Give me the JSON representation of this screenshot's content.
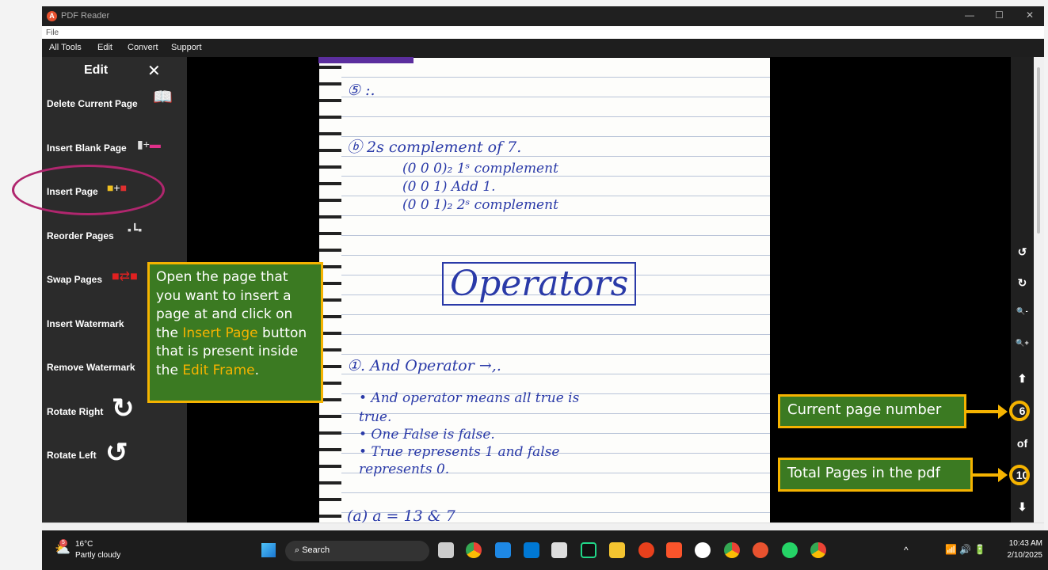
{
  "window": {
    "title": "PDF Reader",
    "min": "—",
    "max": "☐",
    "close": "✕"
  },
  "menu": {
    "file": "File"
  },
  "toolbar": [
    "All Tools",
    "Edit",
    "Convert",
    "Support"
  ],
  "sidebar": {
    "title": "Edit",
    "close": "✕",
    "items": [
      "Delete Current Page",
      "Insert Blank Page",
      "Insert Page",
      "Reorder Pages",
      "Swap Pages",
      "Insert Watermark",
      "Remove Watermark",
      "Rotate Right",
      "Rotate Left"
    ]
  },
  "page_content": {
    "lines": [
      "⑤ :.",
      "ⓑ  2s  complement  of  7.",
      "(0 0 0)₂     1ˢ  complement",
      "(0 0 1)         Add 1.",
      "(0 0 1)₂     2ˢ  complement",
      "Operators",
      "①. And Operator →,.",
      "• And  operator  means  all  true  is",
      "  true.",
      "• One  False  is  false.",
      "• True  represents  1  and  false",
      "  represents  0.",
      "(a)   a  =  13  & 7"
    ]
  },
  "right_toolbar": {
    "rotate_left": "↺",
    "rotate_right": "↻",
    "zoom_out": "🔍-",
    "zoom_in": "🔍+",
    "prev": "⬆",
    "current_page": "6",
    "of": "of",
    "total_pages": "10",
    "next": "⬇"
  },
  "annotations": {
    "callout_parts": [
      "Open the page that you want to insert a  page at and click on the ",
      "Insert Page",
      " button that is present inside the ",
      "Edit Frame",
      "."
    ],
    "current_page_label": "Current page number",
    "total_pages_label": "Total Pages in the pdf",
    "accent": "#f5b300",
    "callout_bg": "#3b7a22",
    "highlight_color": "#b0266e"
  },
  "taskbar": {
    "weather_temp": "16°C",
    "weather_desc": "Partly cloudy",
    "weather_badge": "5",
    "search": "Search",
    "time": "10:43 AM",
    "date": "2/10/2025",
    "tray": "^"
  }
}
